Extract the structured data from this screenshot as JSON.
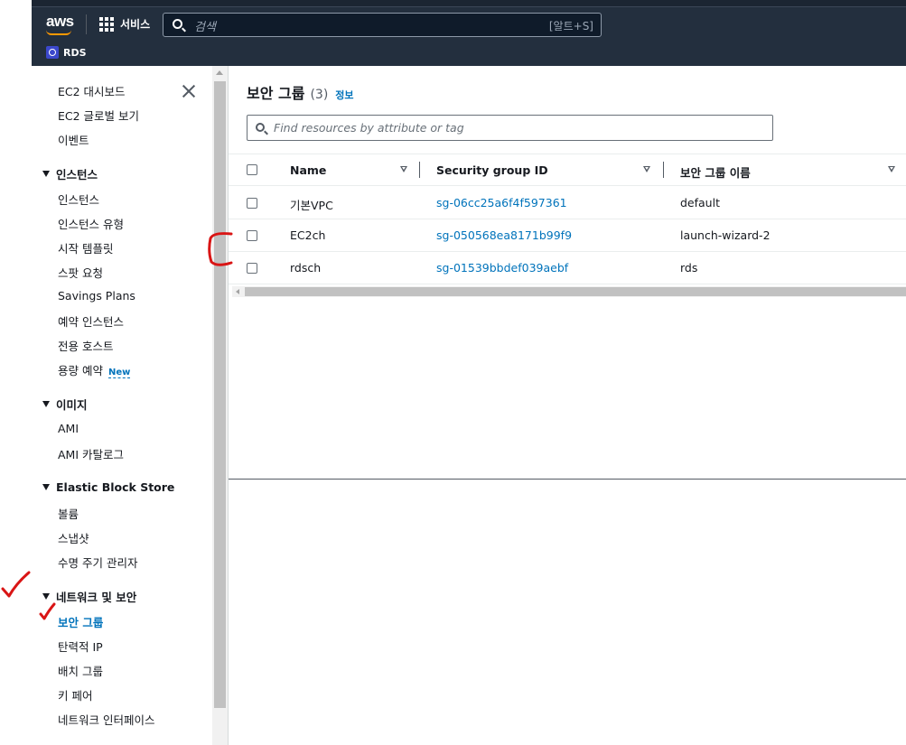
{
  "topnav": {
    "logo": "aws",
    "services_label": "서비스",
    "search_placeholder": "검색",
    "search_shortcut": "[알트+S]",
    "favorite_label": "RDS"
  },
  "sidebar": {
    "top_items": [
      "EC2 대시보드",
      "EC2 글로벌 보기",
      "이벤트"
    ],
    "sections": [
      {
        "title": "인스턴스",
        "items": [
          "인스턴스",
          "인스턴스 유형",
          "시작 템플릿",
          "스팟 요청",
          "Savings Plans",
          "예약 인스턴스",
          "전용 호스트",
          "용량 예약"
        ]
      },
      {
        "title": "이미지",
        "items": [
          "AMI",
          "AMI 카탈로그"
        ]
      },
      {
        "title": "Elastic Block Store",
        "items": [
          "볼륨",
          "스냅샷",
          "수명 주기 관리자"
        ]
      },
      {
        "title": "네트워크 및 보안",
        "items": [
          "보안 그룹",
          "탄력적 IP",
          "배치 그룹",
          "키 페어",
          "네트워크 인터페이스"
        ]
      }
    ],
    "new_badge": "New",
    "active_item": "보안 그룹"
  },
  "main": {
    "title": "보안 그룹",
    "count": "(3)",
    "info_link": "정보",
    "filter_placeholder": "Find resources by attribute or tag",
    "columns": [
      "Name",
      "Security group ID",
      "보안 그룹 이름"
    ],
    "rows": [
      {
        "name": "기본VPC",
        "id": "sg-06cc25a6f4f597361",
        "group_name": "default"
      },
      {
        "name": "EC2ch",
        "id": "sg-050568ea8171b99f9",
        "group_name": "launch-wizard-2"
      },
      {
        "name": "rdsch",
        "id": "sg-01539bbdef039aebf",
        "group_name": "rds"
      }
    ]
  },
  "colors": {
    "nav_bg": "#232f3e",
    "link": "#0073bb",
    "accent_orange": "#ff9900",
    "annotation_red": "#d91515"
  }
}
